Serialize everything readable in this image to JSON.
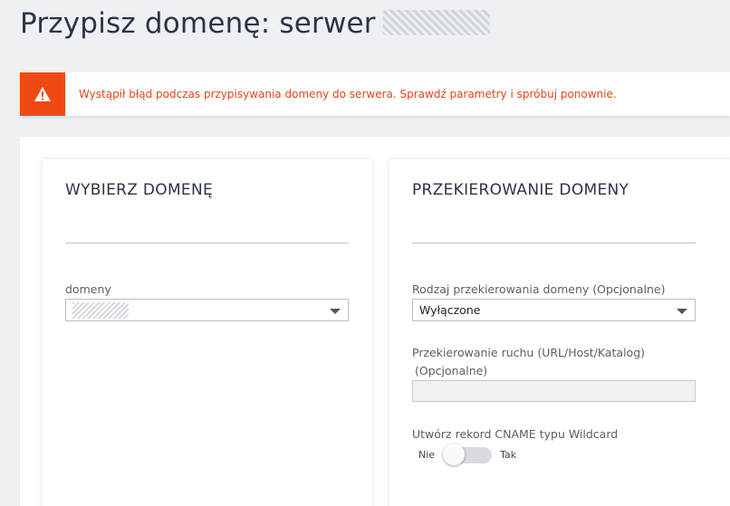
{
  "page": {
    "title": "Przypisz domenę: serwer"
  },
  "alert": {
    "icon": "warning-triangle-icon",
    "message": "Wystąpił błąd podczas przypisywania domeny do serwera. Sprawdź parametry i spróbuj ponownie.",
    "color": "#f04a14"
  },
  "domain_panel": {
    "title": "WYBIERZ DOMENĘ",
    "domain_label": "domeny"
  },
  "redirect_panel": {
    "title": "PRZEKIEROWANIE DOMENY",
    "redirect_type_label": "Rodzaj przekierowania domeny (Opcjonalne)",
    "redirect_type_value": "Wyłączone",
    "traffic_label_line1": "Przekierowanie ruchu (URL/Host/Katalog)",
    "traffic_label_line2": "(Opcjonalne)",
    "traffic_value": "",
    "wildcard_label": "Utwórz rekord CNAME typu Wildcard",
    "toggle_off_label": "Nie",
    "toggle_on_label": "Tak",
    "wildcard_enabled": false
  }
}
